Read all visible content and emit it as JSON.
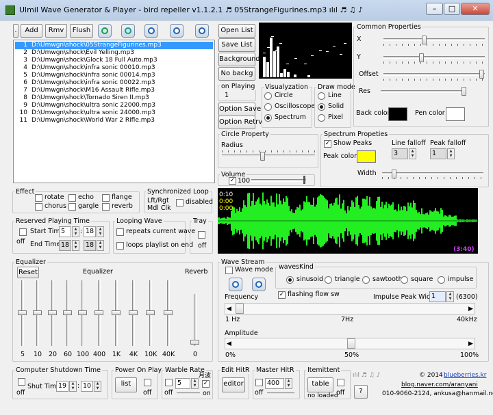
{
  "window": {
    "title": "Ulmil Wave Generator & Player - bird repeller v1.1.2.1   ♬ 05StrangeFigurines.mp3  ılıl ♬ ♫ ♪",
    "min": "–",
    "max": "□",
    "close": "✕"
  },
  "toolbar": {
    "dot": ".",
    "add": "Add",
    "rmv": "Rmv",
    "flush": "Flush"
  },
  "playlist": {
    "items": [
      {
        "num": "1",
        "path": "D:\\Umwgn\\shock\\05StrangeFigurines.mp3",
        "selected": true
      },
      {
        "num": "2",
        "path": "D:\\Umwgn\\shock\\Evil Yelling.mp3"
      },
      {
        "num": "3",
        "path": "D:\\Umwgn\\shock\\Glock 18 Full Auto.mp3"
      },
      {
        "num": "4",
        "path": "D:\\Umwgn\\shock\\infra sonic 00010.mp3"
      },
      {
        "num": "5",
        "path": "D:\\Umwgn\\shock\\infra sonic 00014.mp3"
      },
      {
        "num": "6",
        "path": "D:\\Umwgn\\shock\\infra sonic 00022.mp3"
      },
      {
        "num": "7",
        "path": "D:\\Umwgn\\shock\\M16 Assault Rifle.mp3"
      },
      {
        "num": "8",
        "path": "D:\\Umwgn\\shock\\Tornado Siren II.mp3"
      },
      {
        "num": "9",
        "path": "D:\\Umwgn\\shock\\ultra sonic 22000.mp3"
      },
      {
        "num": "10",
        "path": "D:\\Umwgn\\shock\\ultra sonic 24000.mp3"
      },
      {
        "num": "11",
        "path": "D:\\Umwgn\\shock\\World War 2 Rifle.mp3"
      }
    ]
  },
  "side": {
    "open_list": "Open List",
    "save_list": "Save List",
    "background": "Background",
    "no_backg": "No backg",
    "on_playing": "on Playing",
    "on_playing_value": "1",
    "option_save": "Option Save",
    "option_retrv": "Option Retrv"
  },
  "visualization": {
    "label": "Visualyzation",
    "circle": "Circle",
    "oscilloscope": "Oscilloscope",
    "spectrum": "Spectrum"
  },
  "draw_mode": {
    "label": "Draw mode",
    "line": "Line",
    "solid": "Solid",
    "pixel": "Pixel"
  },
  "common": {
    "label": "Common Properties",
    "x": "X",
    "y": "Y",
    "offset": "Offset",
    "res": "Res",
    "back_color": "Back color",
    "pen_color": "Pen color",
    "back_color_hex": "#000000",
    "pen_color_hex": "#ffffff"
  },
  "circle_property": {
    "label": "Circle Property",
    "radius": "Radius"
  },
  "spectrum_props": {
    "label": "Spectrum Propeties",
    "show_peaks": "Show Peaks",
    "line_falloff": "Line falloff",
    "peak_falloff": "Peak falloff",
    "line_falloff_value": "3",
    "peak_falloff_value": "1",
    "peak_color": "Peak color",
    "peak_color_hex": "#ffff00",
    "width": "Width"
  },
  "volume": {
    "label": "Volume",
    "value": "100"
  },
  "effect": {
    "label": "Effect",
    "rotate": "rotate",
    "echo": "echo",
    "flange": "flange",
    "chorus": "chorus",
    "gargle": "gargle",
    "reverb": "reverb"
  },
  "sync_loop": {
    "label": "Synchronized Loop",
    "lft_rgt": "Lft/Rgt",
    "mdl_clk": "Mdl Clk",
    "disabled": "disabled"
  },
  "waveform": {
    "time_top": "0:10",
    "time_a": "0:00",
    "time_b": "0:00",
    "duration": "(3:40)"
  },
  "reserved": {
    "label": "Reserved Playing Time",
    "off": "off",
    "start_time": "Start Time",
    "start_h": "5",
    "start_m": "18",
    "end_time": "End Time",
    "end_h": "18",
    "end_m": "18"
  },
  "looping": {
    "label": "Looping Wave",
    "repeats": "repeats current wave",
    "loops": "loops playlist on end"
  },
  "tray": {
    "label": "Tray",
    "off": "off"
  },
  "equalizer": {
    "label": "Equalizer",
    "reset": "Reset",
    "reverb": "Reverb",
    "bands": [
      "5",
      "10",
      "20",
      "60",
      "100",
      "400",
      "1K",
      "4K",
      "10K",
      "40K",
      "0"
    ]
  },
  "wave_stream": {
    "label": "Wave Stream",
    "wave_mode": "Wave mode",
    "waves_kind": "wavesKind",
    "sinusoid": "sinusoid",
    "triangle": "triangle",
    "sawtooth": "sawtooth",
    "square": "square",
    "impulse": "impulse",
    "frequency": "Frequency",
    "flashing": "flashing flow sw",
    "impulse_peak": "Impulse Peak Width",
    "impulse_value": "1",
    "impulse_max": "(6300)",
    "f_min": "1 Hz",
    "f_mid": "7Hz",
    "f_max": "40kHz",
    "amplitude": "Amplitude",
    "a_min": "0%",
    "a_mid": "50%",
    "a_max": "100%"
  },
  "shutdown": {
    "label": "Computer Shutdown Time",
    "off": "off",
    "shut_time": "Shut Time",
    "h": "19",
    "m": "10"
  },
  "power_on": {
    "label": "Power On Play",
    "list": "list",
    "off": "off"
  },
  "warble": {
    "label": "Warble Rate",
    "value": "5",
    "off": "off",
    "on": "on",
    "moon": "月波"
  },
  "edit_hitr": {
    "label": "Edit HitR",
    "editor": "editor"
  },
  "master_hitr": {
    "label": "Master HitR",
    "value": "400",
    "off": "off"
  },
  "itemittent": {
    "label": "Itemittent",
    "table": "table",
    "no_loaded": "no loaded",
    "off": "off"
  },
  "about": {
    "notes": "ılıl ♬ ♫ ♪",
    "copyright": "© 2014",
    "site": "blueberries.kr",
    "blog": "blog.naver.com/aranyani",
    "contact": "010-9060-2124, ankusa@hanmail.net",
    "help": "?"
  }
}
